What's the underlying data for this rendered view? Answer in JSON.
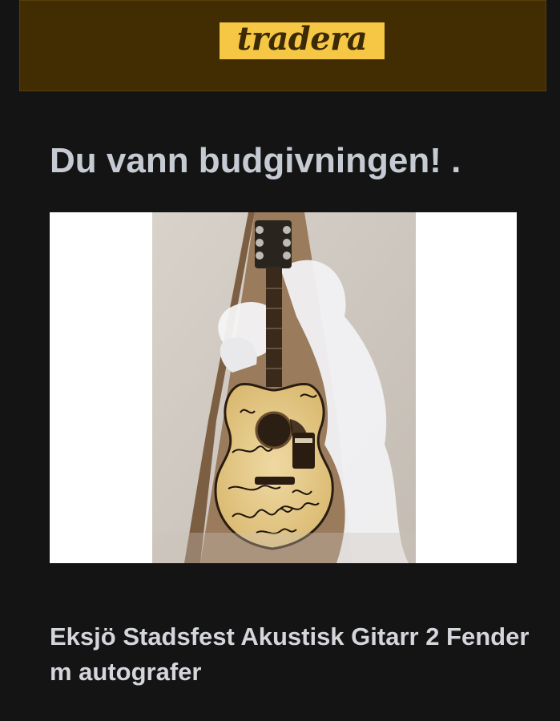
{
  "header": {
    "logo_text": "tradera",
    "background_color": "#422c02",
    "logo_color": "#f6c744"
  },
  "main": {
    "headline": "Du vann budgivningen! .",
    "item_image_icon": "acoustic-guitar-photo",
    "item_title": "Eksjö Stadsfest Akustisk Gitarr 2 Fender m autografer"
  }
}
